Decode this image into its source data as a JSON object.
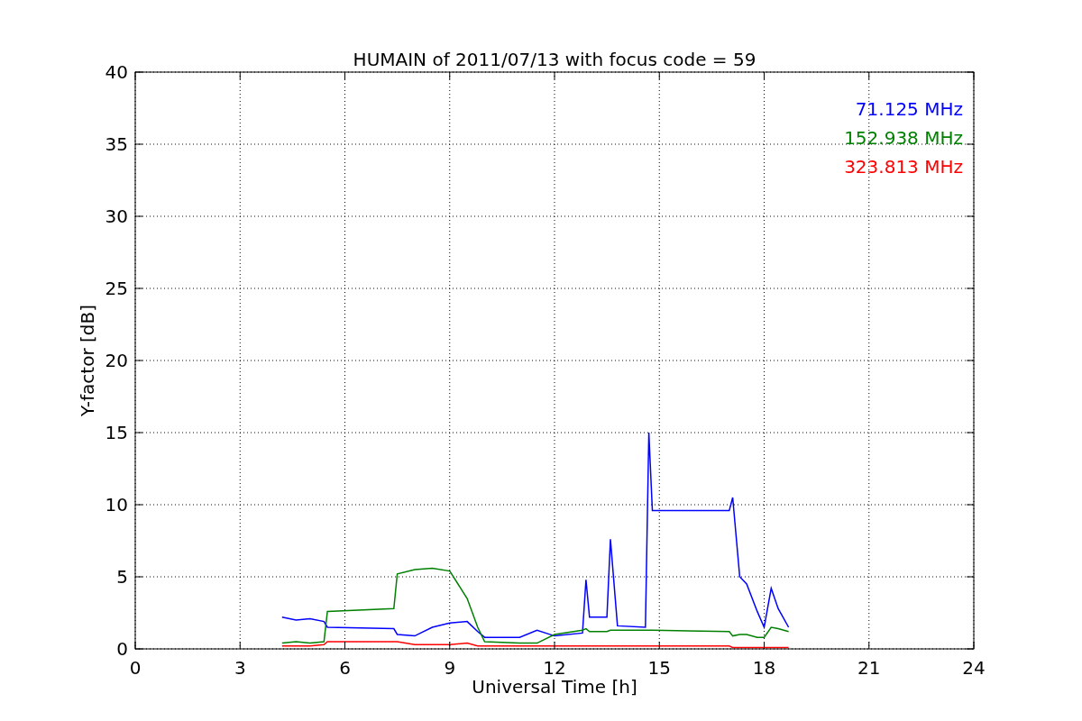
{
  "figure": {
    "chart_data": {
      "type": "line",
      "title": "HUMAIN of 2011/07/13 with focus code = 59",
      "xlabel": "Universal Time [h]",
      "ylabel": "Y-factor [dB]",
      "x": [
        4.2,
        4.6,
        5.0,
        5.4,
        5.5,
        7.4,
        7.5,
        8.0,
        8.5,
        9.0,
        9.5,
        9.8,
        10.0,
        11.0,
        11.5,
        12.0,
        12.8,
        12.9,
        13.0,
        13.5,
        13.6,
        13.8,
        14.6,
        14.7,
        14.8,
        17.0,
        17.1,
        17.3,
        17.5,
        17.8,
        18.0,
        18.2,
        18.4,
        18.7
      ],
      "series": [
        {
          "name": "71.125 MHz",
          "color": "#0000ff",
          "values": [
            2.2,
            2.0,
            2.1,
            1.9,
            1.5,
            1.4,
            1.0,
            0.9,
            1.5,
            1.8,
            1.9,
            1.2,
            0.8,
            0.8,
            1.3,
            0.9,
            1.1,
            4.8,
            2.2,
            2.2,
            7.6,
            1.6,
            1.5,
            15.0,
            9.6,
            9.6,
            10.5,
            5.0,
            4.5,
            2.6,
            1.5,
            4.2,
            2.8,
            1.5
          ]
        },
        {
          "name": "152.938 MHz",
          "color": "#008000",
          "values": [
            0.4,
            0.5,
            0.4,
            0.5,
            2.6,
            2.8,
            5.2,
            5.5,
            5.6,
            5.4,
            3.5,
            1.5,
            0.5,
            0.4,
            0.4,
            1.0,
            1.3,
            1.4,
            1.2,
            1.2,
            1.3,
            1.3,
            1.3,
            1.3,
            1.3,
            1.2,
            0.9,
            1.0,
            1.0,
            0.8,
            0.8,
            1.5,
            1.4,
            1.2
          ]
        },
        {
          "name": "323.813 MHz",
          "color": "#ff0000",
          "values": [
            0.2,
            0.2,
            0.2,
            0.3,
            0.5,
            0.5,
            0.5,
            0.3,
            0.3,
            0.3,
            0.4,
            0.2,
            0.2,
            0.2,
            0.2,
            0.2,
            0.2,
            0.2,
            0.2,
            0.2,
            0.2,
            0.2,
            0.2,
            0.2,
            0.2,
            0.2,
            0.1,
            0.1,
            0.1,
            0.1,
            0.1,
            0.1,
            0.1,
            0.1
          ]
        }
      ],
      "xlim": [
        0,
        24
      ],
      "ylim": [
        0,
        40
      ],
      "xticks": [
        0,
        3,
        6,
        9,
        12,
        15,
        18,
        21,
        24
      ],
      "yticks": [
        0,
        5,
        10,
        15,
        20,
        25,
        30,
        35,
        40
      ],
      "grid": true
    }
  }
}
